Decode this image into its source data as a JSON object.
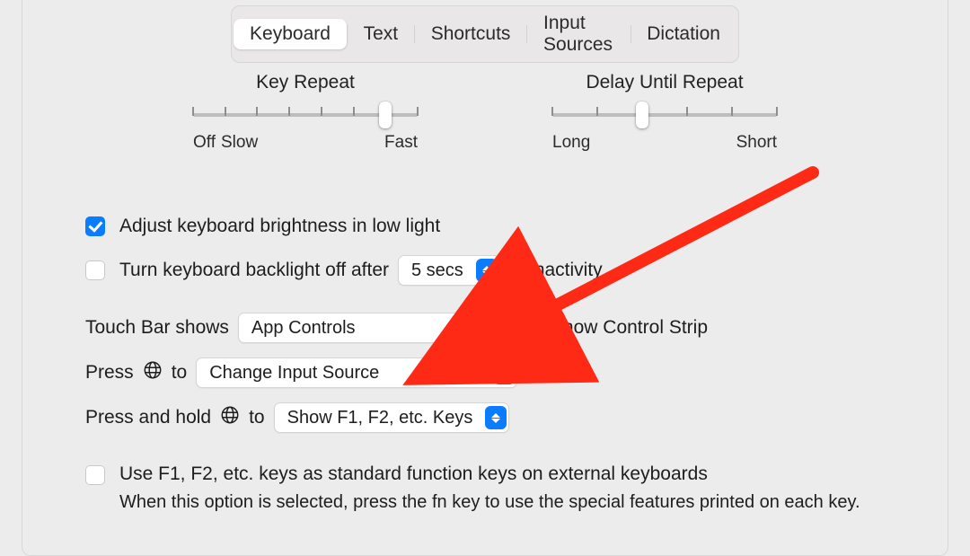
{
  "tabs": {
    "keyboard": "Keyboard",
    "text": "Text",
    "shortcuts": "Shortcuts",
    "input_sources": "Input Sources",
    "dictation": "Dictation",
    "active": "keyboard"
  },
  "sliders": {
    "key_repeat": {
      "title": "Key Repeat",
      "left_label": "Off",
      "left_label2": "Slow",
      "right_label": "Fast",
      "ticks": 8,
      "value_index": 6
    },
    "delay_until_repeat": {
      "title": "Delay Until Repeat",
      "left_label": "Long",
      "right_label": "Short",
      "ticks": 6,
      "value_index": 2
    }
  },
  "checks": {
    "adjust_brightness": {
      "checked": true,
      "label": "Adjust keyboard brightness in low light"
    },
    "backlight_off": {
      "checked": false,
      "label_before": "Turn keyboard backlight off after",
      "popup_value": "5 secs",
      "label_after": "of inactivity"
    },
    "touch_bar_shows": {
      "label": "Touch Bar shows",
      "popup_value": "App Controls"
    },
    "show_control_strip": {
      "checked": true,
      "label": "Show Control Strip"
    },
    "press_globe_to": {
      "label_prefix": "Press",
      "label_suffix": "to",
      "popup_value": "Change Input Source"
    },
    "press_hold_globe_to": {
      "label_prefix": "Press and hold",
      "label_suffix": "to",
      "popup_value": "Show F1, F2, etc. Keys"
    },
    "use_fn_keys": {
      "checked": false,
      "label": "Use F1, F2, etc. keys as standard function keys on external keyboards",
      "note": "When this option is selected, press the fn key to use the special features printed on each key."
    }
  }
}
